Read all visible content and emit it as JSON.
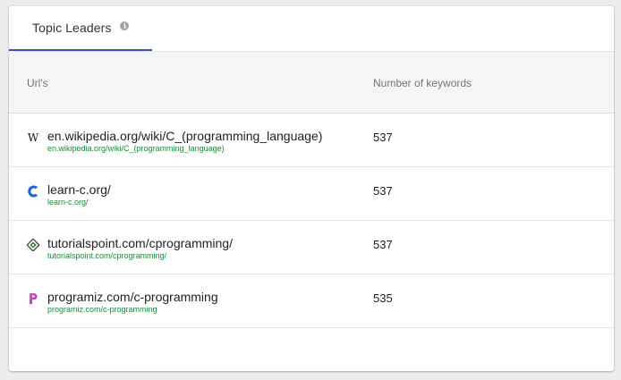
{
  "tab": {
    "label": "Topic Leaders",
    "info_icon": "info-icon"
  },
  "table": {
    "headers": {
      "url": "Url's",
      "keywords": "Number of keywords"
    },
    "rows": [
      {
        "icon": "wikipedia-icon",
        "url": "en.wikipedia.org/wiki/C_(programming_language)",
        "sub_url": "en.wikipedia.org/wiki/C_(programming_language)",
        "keywords": "537"
      },
      {
        "icon": "learn-c-icon",
        "url": "learn-c.org/",
        "sub_url": "learn-c.org/",
        "keywords": "537"
      },
      {
        "icon": "tutorialspoint-icon",
        "url": "tutorialspoint.com/cprogramming/",
        "sub_url": "tutorialspoint.com/cprogramming/",
        "keywords": "537"
      },
      {
        "icon": "programiz-icon",
        "url": "programiz.com/c-programming",
        "sub_url": "programiz.com/c-programming",
        "keywords": "535"
      }
    ]
  },
  "colors": {
    "accent": "#3f51b5",
    "sub_url": "#1b8a3a",
    "header_bg": "#f5f5f5"
  }
}
